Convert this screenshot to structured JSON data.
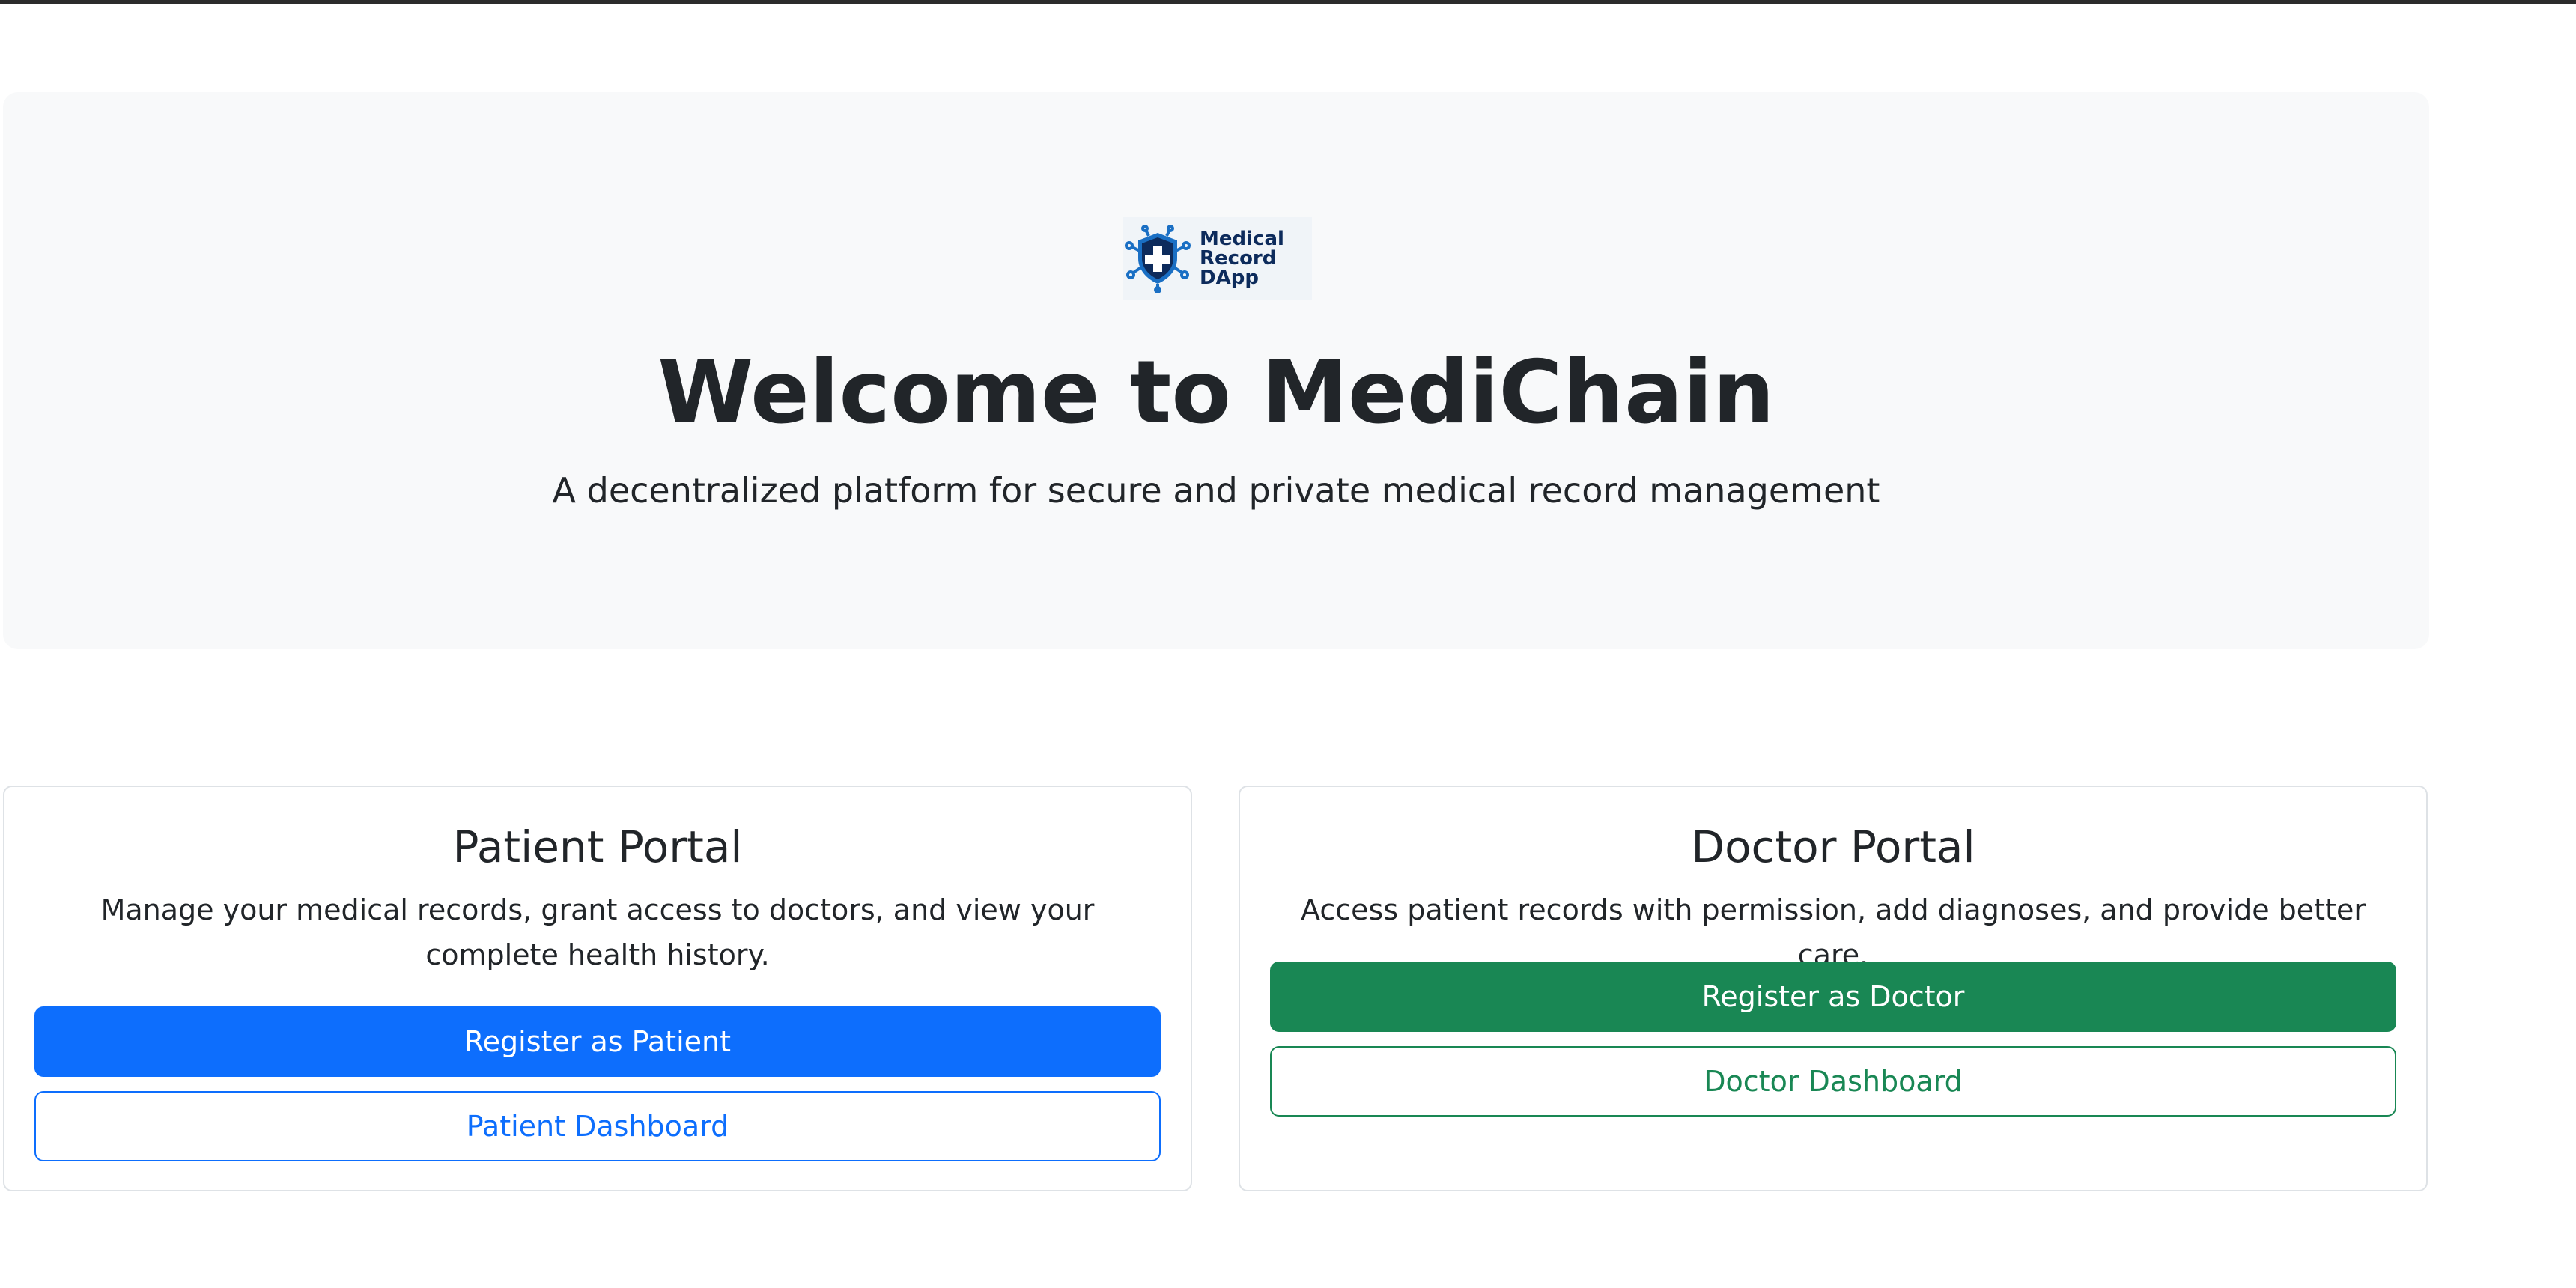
{
  "logo": {
    "lines": [
      "Medical",
      "Record",
      "DApp"
    ],
    "icon": "shield-medical-icon"
  },
  "hero": {
    "title": "Welcome to MediChain",
    "subtitle": "A decentralized platform for secure and private medical record management"
  },
  "patient_portal": {
    "title": "Patient Portal",
    "description": "Manage your medical records, grant access to doctors, and view your complete health history.",
    "register_label": "Register as Patient",
    "dashboard_label": "Patient Dashboard"
  },
  "doctor_portal": {
    "title": "Doctor Portal",
    "description": "Access patient records with permission, add diagnoses, and provide better care.",
    "register_label": "Register as Doctor",
    "dashboard_label": "Doctor Dashboard"
  },
  "colors": {
    "primary": "#0d6efd",
    "success": "#198754",
    "hero_bg": "#f8f9fa",
    "logo_navy": "#0d2b5c",
    "logo_blue": "#1a6fc4"
  }
}
